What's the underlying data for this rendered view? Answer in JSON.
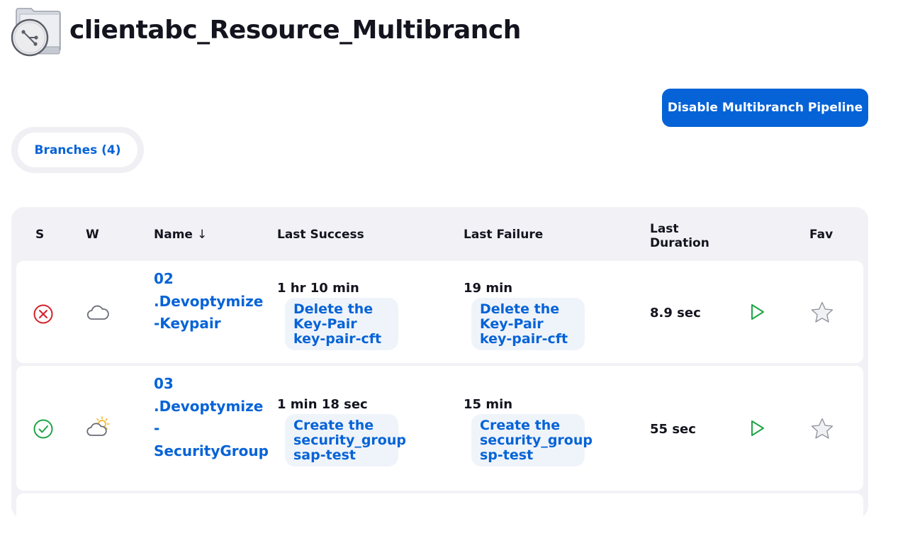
{
  "page": {
    "title": "clientabc_Resource_Multibranch"
  },
  "actions": {
    "disable_label": "Disable Multibranch Pipeline"
  },
  "tabs": [
    {
      "label": "Branches (4)",
      "active": true
    }
  ],
  "table": {
    "headers": {
      "status": "S",
      "weather": "W",
      "name": "Name",
      "sort_indicator": "↓",
      "last_success": "Last Success",
      "last_failure": "Last Failure",
      "last_duration": "Last Duration",
      "fav": "Fav"
    },
    "rows": [
      {
        "status": "failed",
        "status_icon": "failure-icon",
        "weather_icon": "cloudy-icon",
        "name_lines": [
          "02",
          ".Devoptymize",
          "-Keypair"
        ],
        "last_success": {
          "time": "1 hr 10 min",
          "build": "Delete the Key-Pair key-pair-cft"
        },
        "last_failure": {
          "time": "19 min",
          "build": "Delete the Key-Pair key-pair-cft"
        },
        "duration": "8.9 sec",
        "run_icon": "play-icon",
        "fav_icon": "star-icon"
      },
      {
        "status": "success",
        "status_icon": "success-icon",
        "weather_icon": "partly-sunny-icon",
        "name_lines": [
          "03",
          ".Devoptymize",
          "-",
          "SecurityGroup"
        ],
        "last_success": {
          "time": "1 min 18 sec",
          "build": "Create the security_group sap-test"
        },
        "last_failure": {
          "time": "15 min",
          "build": "Create the security_group sp-test"
        },
        "duration": "55 sec",
        "run_icon": "play-icon",
        "fav_icon": "star-icon"
      }
    ]
  },
  "colors": {
    "accent": "#0663d7",
    "failure": "#d4202a",
    "success": "#1ea446",
    "text": "#14141f",
    "table_bg": "#f2f2f6",
    "pill_bg": "#eff4fa"
  }
}
